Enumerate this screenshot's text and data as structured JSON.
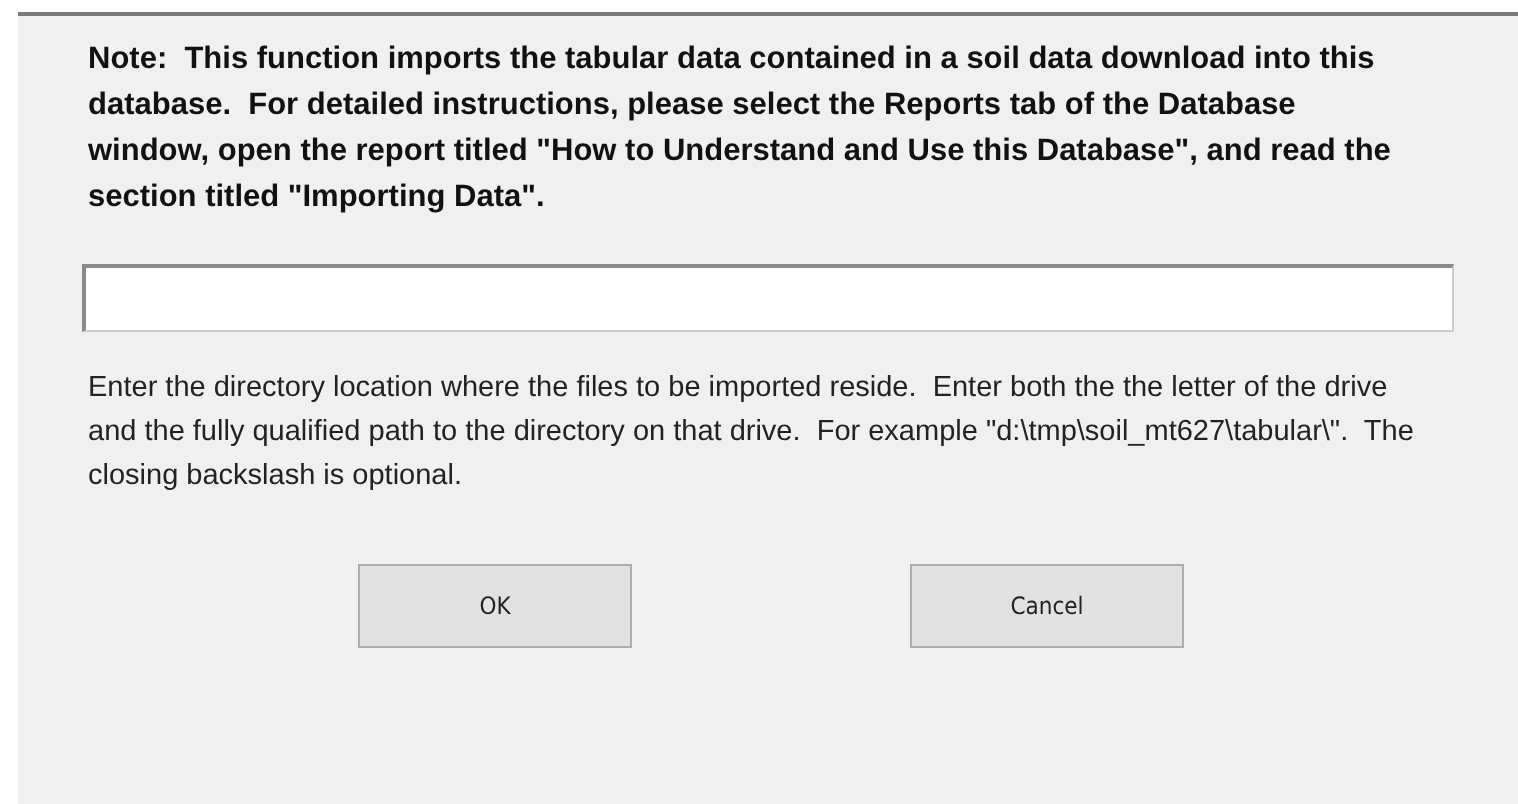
{
  "note": "Note:  This function imports the tabular data contained in a soil data download into this database.  For detailed instructions, please select the Reports tab of the Database window, open the report titled \"How to Understand and Use this Database\", and read the section titled \"Importing Data\".",
  "help": "Enter the directory location where the files to be imported reside.  Enter both the the letter of the drive and the fully qualified path to the directory on that drive.  For example \"d:\\tmp\\soil_mt627\\tabular\\\".  The closing backslash is optional.",
  "buttons": [
    "OK",
    "Cancel"
  ]
}
